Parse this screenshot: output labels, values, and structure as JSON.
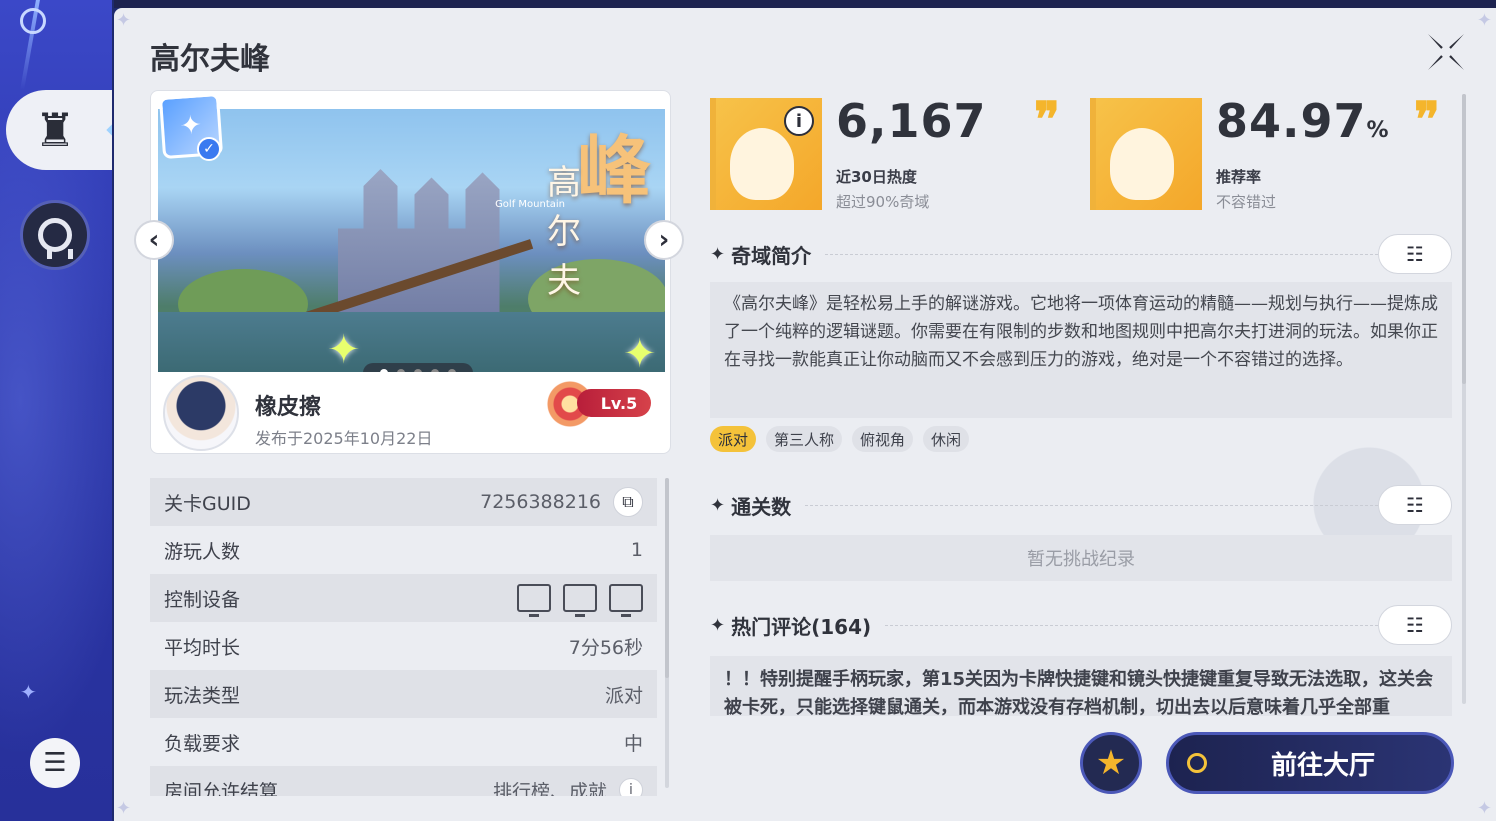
{
  "page": {
    "title": "高尔夫峰"
  },
  "level": {
    "cover_title_big": "峰",
    "cover_title_small": "高尔夫",
    "cover_subtitle": "Golf Mountain",
    "author": "橡皮擦",
    "published": "发布于2025年10月22日",
    "author_level": "Lv.5",
    "carousel_total": 5,
    "carousel_active": 1
  },
  "stats": {
    "heat": {
      "value": "6,167",
      "label": "近30日热度",
      "sub": "超过90%奇域"
    },
    "rating": {
      "value": "84.97",
      "unit": "%",
      "label": "推荐率",
      "sub": "不容错过"
    }
  },
  "info_rows": [
    {
      "key": "关卡GUID",
      "value": "7256388216"
    },
    {
      "key": "游玩人数",
      "value": "1"
    },
    {
      "key": "控制设备",
      "value": ""
    },
    {
      "key": "平均时长",
      "value": "7分56秒"
    },
    {
      "key": "玩法类型",
      "value": "派对"
    },
    {
      "key": "负载要求",
      "value": "中"
    },
    {
      "key": "房间允许结算",
      "value": "排行榜、成就"
    }
  ],
  "sections": {
    "intro": {
      "title": "奇域简介",
      "text": "《高尔夫峰》是轻松易上手的解谜游戏。它地将一项体育运动的精髓——规划与执行——提炼成了一个纯粹的逻辑谜题。你需要在有限制的步数和地图规则中把高尔夫打进洞的玩法。如果你正在寻找一款能真正让你动脑而又不会感到压力的游戏，绝对是一个不容错过的选择。",
      "tags": [
        "派对",
        "第三人称",
        "俯视角",
        "休闲"
      ]
    },
    "clears": {
      "title": "通关数",
      "empty": "暂无挑战纪录"
    },
    "comments": {
      "title": "热门评论(164)",
      "text": "！！特别提醒手柄玩家，第15关因为卡牌快捷键和镜头快捷键重复导致无法选取，这关会被卡死，只能选择键鼠通关，而本游戏没有存档机制，切出去以后意味着几乎全部重"
    }
  },
  "actions": {
    "go_label": "前往大厅"
  },
  "colors": {
    "accent": "#f4b52c",
    "sidebar": "#2b36a8",
    "button": "#1d2350"
  },
  "icons": {
    "close": "close-x-icon",
    "prev": "chevron-left-icon",
    "next": "chevron-right-icon",
    "copy": "copy-icon",
    "filter": "filter-list-icon",
    "favorite": "star-icon",
    "menu": "hamburger-icon",
    "chess": "chess-rook-icon",
    "medal": "medal-icon"
  }
}
